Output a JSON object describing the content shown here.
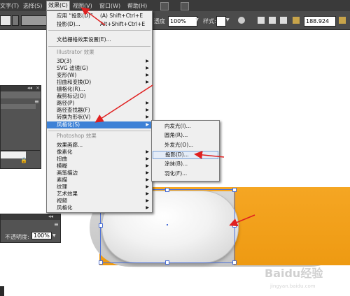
{
  "menubar": {
    "items": [
      "文字(T)",
      "选择(S)",
      "效果(C)",
      "视图(V)",
      "窗口(W)",
      "帮助(H)"
    ]
  },
  "control_bar": {
    "opacity_label": "透度",
    "opacity_value": "100%",
    "style_label": "样式:",
    "w_value": "188.924"
  },
  "left_panel": {
    "opacity_label": "不透明度:",
    "opacity_value": "100%"
  },
  "effect_menu": {
    "top_items": [
      {
        "label": "应用 “投影(D)”",
        "shortcut": "(A)    Shift+Ctrl+E"
      },
      {
        "label": "投影(D)...",
        "shortcut": "Alt+Shift+Ctrl+E"
      }
    ],
    "doc_settings": "文档栅格效果设置(E)...",
    "illustrator_header": "Illustrator 效果",
    "illustrator_items": [
      "3D(3)",
      "SVG 滤镜(G)",
      "变形(W)",
      "扭曲和变换(D)",
      "栅格化(R)...",
      "裁剪标记(O)",
      "路径(P)",
      "路径查找器(F)",
      "转换为形状(V)",
      "风格化(S)"
    ],
    "photoshop_header": "Photoshop 效果",
    "photoshop_items": [
      "效果画廊...",
      "像素化",
      "扭曲",
      "模糊",
      "画笔描边",
      "素描",
      "纹理",
      "艺术效果",
      "视频",
      "风格化"
    ]
  },
  "stylize_submenu": {
    "items": [
      "内发光(I)...",
      "圆角(R)...",
      "外发光(O)...",
      "投影(D)...",
      "涂抹(B)...",
      "羽化(F)..."
    ]
  },
  "watermark": {
    "logo": "Baidu经验",
    "url": "jingyan.baidu.com"
  },
  "colors": {
    "highlight": "#3d81d6",
    "orange": "#f5a623",
    "arrow": "#e02020",
    "selection": "#4a6fd8"
  }
}
